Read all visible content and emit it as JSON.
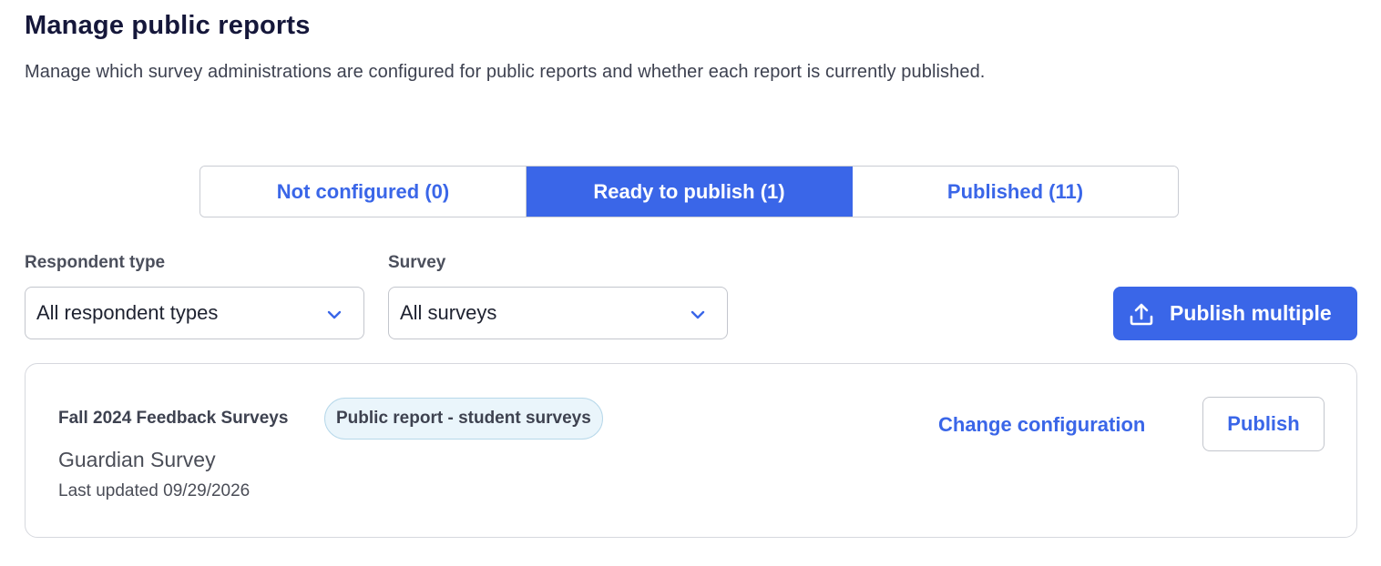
{
  "header": {
    "title": "Manage public reports",
    "description": "Manage which survey administrations are configured for public reports and whether each report is currently published."
  },
  "tabs": [
    {
      "label": "Not configured (0)",
      "active": false
    },
    {
      "label": "Ready to publish (1)",
      "active": true
    },
    {
      "label": "Published (11)",
      "active": false
    }
  ],
  "filters": {
    "respondent_type": {
      "label": "Respondent type",
      "value": "All respondent types",
      "icon": "chevron-down-icon"
    },
    "survey": {
      "label": "Survey",
      "value": "All surveys",
      "icon": "chevron-down-icon"
    }
  },
  "actions": {
    "publish_multiple": {
      "label": "Publish multiple",
      "icon": "upload-icon"
    }
  },
  "reports": [
    {
      "administration": "Fall 2024 Feedback Surveys",
      "badge": "Public report - student surveys",
      "survey": "Guardian Survey",
      "last_updated": "Last updated 09/29/2026",
      "change_label": "Change configuration",
      "publish_label": "Publish"
    }
  ],
  "colors": {
    "accent": "#3a66e8",
    "title": "#15173a",
    "badge_bg": "#eaf5fb",
    "badge_border": "#b7d8ea",
    "border": "#c9ccd3"
  }
}
